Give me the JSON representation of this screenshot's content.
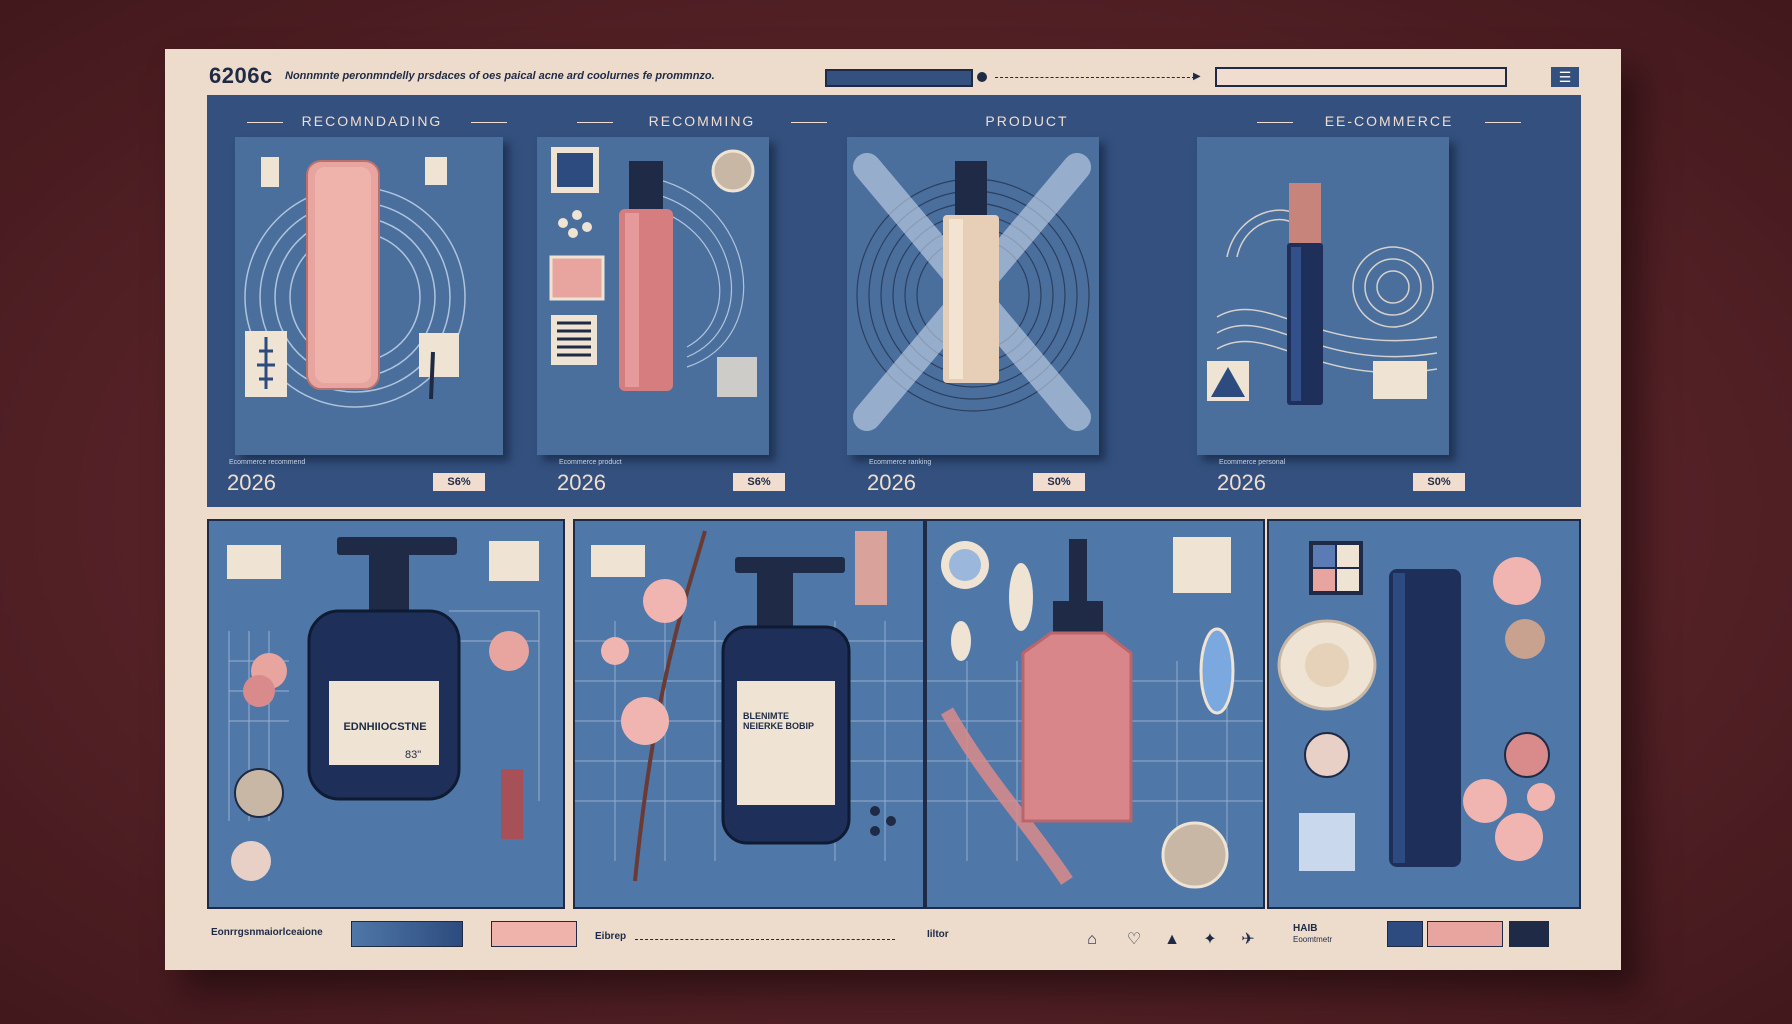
{
  "header": {
    "brand": "6206c",
    "tagline": "Nonnmnte peronmndelly prsdaces of oes paical acne ard coolurnes fe prommnzo."
  },
  "top_cards": [
    {
      "heading": "RECOMNDADING",
      "year": "2026",
      "badge": "S6%",
      "meta": "Ecommerce recommend"
    },
    {
      "heading": "RECOMMING",
      "year": "2026",
      "badge": "S6%",
      "meta": "Ecommerce product"
    },
    {
      "heading": "PRODUCT",
      "year": "2026",
      "badge": "S0%",
      "meta": "Ecommerce ranking"
    },
    {
      "heading": "EE-COMMERCE",
      "year": "2026",
      "badge": "S0%",
      "meta": "Ecommerce personal"
    }
  ],
  "lower_cards": [
    {
      "label_title": "EDNHIIOCSTNE",
      "label_price": "83\""
    },
    {
      "label_title": "BLENIMTE NEIERKE BOBIP",
      "label_price": ""
    },
    {
      "label_title": "",
      "label_price": ""
    },
    {
      "label_title": "",
      "label_price": ""
    }
  ],
  "footer": {
    "left_label": "Eonrrgsnmaiorlceaione",
    "mid_label_1": "Eibrep",
    "mid_label_2": "Iiltor",
    "right_label_1": "HAIB",
    "right_label_2": "Eoomtmetr"
  },
  "icons": {
    "menu": "menu-icon",
    "footer": [
      "bag-icon",
      "heart-icon",
      "bell-icon",
      "star-icon",
      "share-icon"
    ]
  },
  "colors": {
    "navy": "#1e2a46",
    "blue": "#33507e",
    "cream": "#eddccb",
    "pink": "#e8a5a0",
    "backdrop": "#5a2428"
  }
}
